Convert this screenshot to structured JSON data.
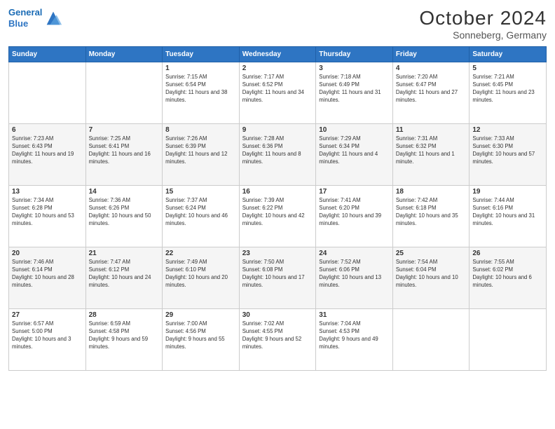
{
  "header": {
    "logo_line1": "General",
    "logo_line2": "Blue",
    "title": "October 2024",
    "subtitle": "Sonneberg, Germany"
  },
  "weekdays": [
    "Sunday",
    "Monday",
    "Tuesday",
    "Wednesday",
    "Thursday",
    "Friday",
    "Saturday"
  ],
  "weeks": [
    [
      {
        "day": "",
        "sunrise": "",
        "sunset": "",
        "daylight": ""
      },
      {
        "day": "",
        "sunrise": "",
        "sunset": "",
        "daylight": ""
      },
      {
        "day": "1",
        "sunrise": "Sunrise: 7:15 AM",
        "sunset": "Sunset: 6:54 PM",
        "daylight": "Daylight: 11 hours and 38 minutes."
      },
      {
        "day": "2",
        "sunrise": "Sunrise: 7:17 AM",
        "sunset": "Sunset: 6:52 PM",
        "daylight": "Daylight: 11 hours and 34 minutes."
      },
      {
        "day": "3",
        "sunrise": "Sunrise: 7:18 AM",
        "sunset": "Sunset: 6:49 PM",
        "daylight": "Daylight: 11 hours and 31 minutes."
      },
      {
        "day": "4",
        "sunrise": "Sunrise: 7:20 AM",
        "sunset": "Sunset: 6:47 PM",
        "daylight": "Daylight: 11 hours and 27 minutes."
      },
      {
        "day": "5",
        "sunrise": "Sunrise: 7:21 AM",
        "sunset": "Sunset: 6:45 PM",
        "daylight": "Daylight: 11 hours and 23 minutes."
      }
    ],
    [
      {
        "day": "6",
        "sunrise": "Sunrise: 7:23 AM",
        "sunset": "Sunset: 6:43 PM",
        "daylight": "Daylight: 11 hours and 19 minutes."
      },
      {
        "day": "7",
        "sunrise": "Sunrise: 7:25 AM",
        "sunset": "Sunset: 6:41 PM",
        "daylight": "Daylight: 11 hours and 16 minutes."
      },
      {
        "day": "8",
        "sunrise": "Sunrise: 7:26 AM",
        "sunset": "Sunset: 6:39 PM",
        "daylight": "Daylight: 11 hours and 12 minutes."
      },
      {
        "day": "9",
        "sunrise": "Sunrise: 7:28 AM",
        "sunset": "Sunset: 6:36 PM",
        "daylight": "Daylight: 11 hours and 8 minutes."
      },
      {
        "day": "10",
        "sunrise": "Sunrise: 7:29 AM",
        "sunset": "Sunset: 6:34 PM",
        "daylight": "Daylight: 11 hours and 4 minutes."
      },
      {
        "day": "11",
        "sunrise": "Sunrise: 7:31 AM",
        "sunset": "Sunset: 6:32 PM",
        "daylight": "Daylight: 11 hours and 1 minute."
      },
      {
        "day": "12",
        "sunrise": "Sunrise: 7:33 AM",
        "sunset": "Sunset: 6:30 PM",
        "daylight": "Daylight: 10 hours and 57 minutes."
      }
    ],
    [
      {
        "day": "13",
        "sunrise": "Sunrise: 7:34 AM",
        "sunset": "Sunset: 6:28 PM",
        "daylight": "Daylight: 10 hours and 53 minutes."
      },
      {
        "day": "14",
        "sunrise": "Sunrise: 7:36 AM",
        "sunset": "Sunset: 6:26 PM",
        "daylight": "Daylight: 10 hours and 50 minutes."
      },
      {
        "day": "15",
        "sunrise": "Sunrise: 7:37 AM",
        "sunset": "Sunset: 6:24 PM",
        "daylight": "Daylight: 10 hours and 46 minutes."
      },
      {
        "day": "16",
        "sunrise": "Sunrise: 7:39 AM",
        "sunset": "Sunset: 6:22 PM",
        "daylight": "Daylight: 10 hours and 42 minutes."
      },
      {
        "day": "17",
        "sunrise": "Sunrise: 7:41 AM",
        "sunset": "Sunset: 6:20 PM",
        "daylight": "Daylight: 10 hours and 39 minutes."
      },
      {
        "day": "18",
        "sunrise": "Sunrise: 7:42 AM",
        "sunset": "Sunset: 6:18 PM",
        "daylight": "Daylight: 10 hours and 35 minutes."
      },
      {
        "day": "19",
        "sunrise": "Sunrise: 7:44 AM",
        "sunset": "Sunset: 6:16 PM",
        "daylight": "Daylight: 10 hours and 31 minutes."
      }
    ],
    [
      {
        "day": "20",
        "sunrise": "Sunrise: 7:46 AM",
        "sunset": "Sunset: 6:14 PM",
        "daylight": "Daylight: 10 hours and 28 minutes."
      },
      {
        "day": "21",
        "sunrise": "Sunrise: 7:47 AM",
        "sunset": "Sunset: 6:12 PM",
        "daylight": "Daylight: 10 hours and 24 minutes."
      },
      {
        "day": "22",
        "sunrise": "Sunrise: 7:49 AM",
        "sunset": "Sunset: 6:10 PM",
        "daylight": "Daylight: 10 hours and 20 minutes."
      },
      {
        "day": "23",
        "sunrise": "Sunrise: 7:50 AM",
        "sunset": "Sunset: 6:08 PM",
        "daylight": "Daylight: 10 hours and 17 minutes."
      },
      {
        "day": "24",
        "sunrise": "Sunrise: 7:52 AM",
        "sunset": "Sunset: 6:06 PM",
        "daylight": "Daylight: 10 hours and 13 minutes."
      },
      {
        "day": "25",
        "sunrise": "Sunrise: 7:54 AM",
        "sunset": "Sunset: 6:04 PM",
        "daylight": "Daylight: 10 hours and 10 minutes."
      },
      {
        "day": "26",
        "sunrise": "Sunrise: 7:55 AM",
        "sunset": "Sunset: 6:02 PM",
        "daylight": "Daylight: 10 hours and 6 minutes."
      }
    ],
    [
      {
        "day": "27",
        "sunrise": "Sunrise: 6:57 AM",
        "sunset": "Sunset: 5:00 PM",
        "daylight": "Daylight: 10 hours and 3 minutes."
      },
      {
        "day": "28",
        "sunrise": "Sunrise: 6:59 AM",
        "sunset": "Sunset: 4:58 PM",
        "daylight": "Daylight: 9 hours and 59 minutes."
      },
      {
        "day": "29",
        "sunrise": "Sunrise: 7:00 AM",
        "sunset": "Sunset: 4:56 PM",
        "daylight": "Daylight: 9 hours and 55 minutes."
      },
      {
        "day": "30",
        "sunrise": "Sunrise: 7:02 AM",
        "sunset": "Sunset: 4:55 PM",
        "daylight": "Daylight: 9 hours and 52 minutes."
      },
      {
        "day": "31",
        "sunrise": "Sunrise: 7:04 AM",
        "sunset": "Sunset: 4:53 PM",
        "daylight": "Daylight: 9 hours and 49 minutes."
      },
      {
        "day": "",
        "sunrise": "",
        "sunset": "",
        "daylight": ""
      },
      {
        "day": "",
        "sunrise": "",
        "sunset": "",
        "daylight": ""
      }
    ]
  ]
}
